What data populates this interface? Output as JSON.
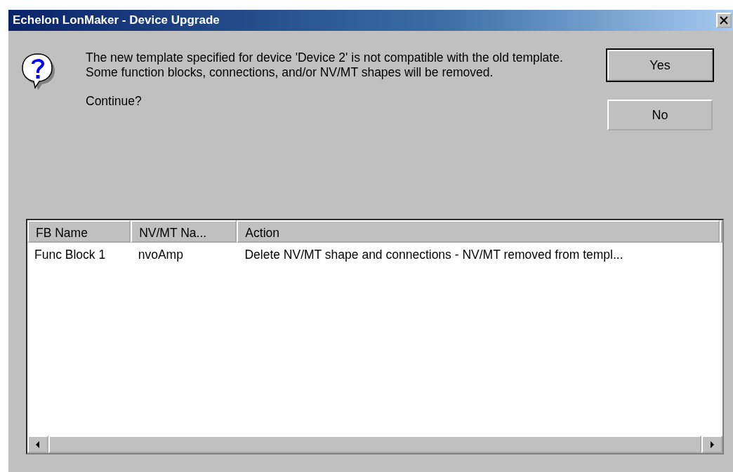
{
  "window": {
    "title": "Echelon LonMaker - Device Upgrade"
  },
  "message": {
    "lines": [
      "The new template specified for device 'Device 2' is not compatible with the old template. Some function blocks, connections, and/or NV/MT shapes will be removed.",
      "Continue?"
    ]
  },
  "buttons": [
    {
      "label": "Yes",
      "default": true
    },
    {
      "label": "No",
      "default": false
    }
  ],
  "table": {
    "columns": [
      "FB Name",
      "NV/MT Na...",
      "Action"
    ],
    "rows": [
      [
        "Func Block 1",
        "nvoAmp",
        "Delete NV/MT shape and connections - NV/MT removed from templ..."
      ]
    ]
  }
}
